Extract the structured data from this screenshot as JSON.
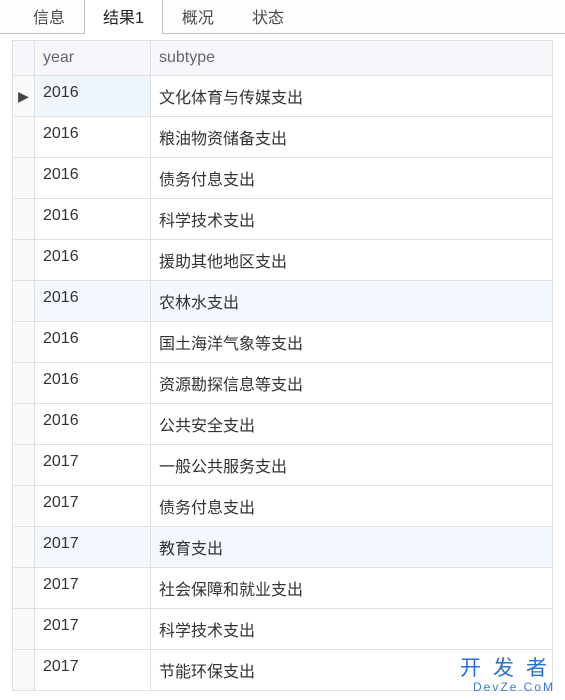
{
  "tabs": [
    {
      "label": "信息",
      "active": false
    },
    {
      "label": "结果1",
      "active": true
    },
    {
      "label": "概况",
      "active": false
    },
    {
      "label": "状态",
      "active": false
    }
  ],
  "columns": {
    "year": "year",
    "subtype": "subtype"
  },
  "current_row_marker": "▶",
  "rows": [
    {
      "year": "2016",
      "subtype": "文化体育与传媒支出",
      "current": true
    },
    {
      "year": "2016",
      "subtype": "粮油物资储备支出"
    },
    {
      "year": "2016",
      "subtype": "债务付息支出"
    },
    {
      "year": "2016",
      "subtype": "科学技术支出"
    },
    {
      "year": "2016",
      "subtype": "援助其他地区支出"
    },
    {
      "year": "2016",
      "subtype": "农林水支出",
      "highlight": true
    },
    {
      "year": "2016",
      "subtype": "国土海洋气象等支出"
    },
    {
      "year": "2016",
      "subtype": "资源勘探信息等支出"
    },
    {
      "year": "2016",
      "subtype": "公共安全支出"
    },
    {
      "year": "2017",
      "subtype": "一般公共服务支出"
    },
    {
      "year": "2017",
      "subtype": "债务付息支出"
    },
    {
      "year": "2017",
      "subtype": "教育支出",
      "highlight": true
    },
    {
      "year": "2017",
      "subtype": "社会保障和就业支出"
    },
    {
      "year": "2017",
      "subtype": "科学技术支出"
    },
    {
      "year": "2017",
      "subtype": "节能环保支出"
    }
  ],
  "watermark": {
    "main": "开发者",
    "sub": "DevZe.CoM"
  }
}
